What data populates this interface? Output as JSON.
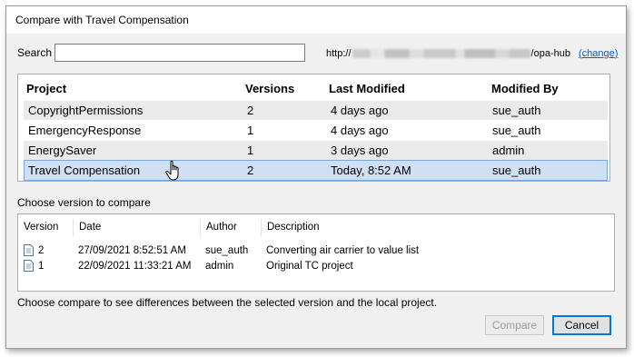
{
  "dialog": {
    "title": "Compare with Travel Compensation"
  },
  "search": {
    "label": "Search",
    "value": "",
    "placeholder": ""
  },
  "server": {
    "url_prefix": "http://",
    "url_suffix": "/opa-hub",
    "change_label": "change"
  },
  "projects": {
    "headers": [
      "Project",
      "Versions",
      "Last Modified",
      "Modified By"
    ],
    "rows": [
      {
        "name": "CopyrightPermissions",
        "versions": "2",
        "modified": "4 days ago",
        "by": "sue_auth"
      },
      {
        "name": "EmergencyResponse",
        "versions": "1",
        "modified": "4 days ago",
        "by": "sue_auth"
      },
      {
        "name": "EnergySaver",
        "versions": "1",
        "modified": "3 days ago",
        "by": "admin"
      },
      {
        "name": "Travel Compensation",
        "versions": "2",
        "modified": "Today, 8:52 AM",
        "by": "sue_auth"
      }
    ],
    "selected_index": 3
  },
  "versions": {
    "section_label": "Choose version to compare",
    "headers": [
      "Version",
      "Date",
      "Author",
      "Description"
    ],
    "rows": [
      {
        "version": "2",
        "date": "27/09/2021 8:52:51 AM",
        "author": "sue_auth",
        "description": "Converting air carrier to value list",
        "icon": "document-icon"
      },
      {
        "version": "1",
        "date": "22/09/2021 11:33:21 AM",
        "author": "admin",
        "description": "Original TC project",
        "icon": "document-icon"
      }
    ]
  },
  "hint": "Choose compare to see differences between the selected version and the local project.",
  "buttons": {
    "compare": "Compare",
    "cancel": "Cancel"
  },
  "colors": {
    "selection": "#cfe0f4",
    "selection_border": "#7aa7dc",
    "link": "#0b5cc9",
    "default_button_border": "#0078d7"
  }
}
